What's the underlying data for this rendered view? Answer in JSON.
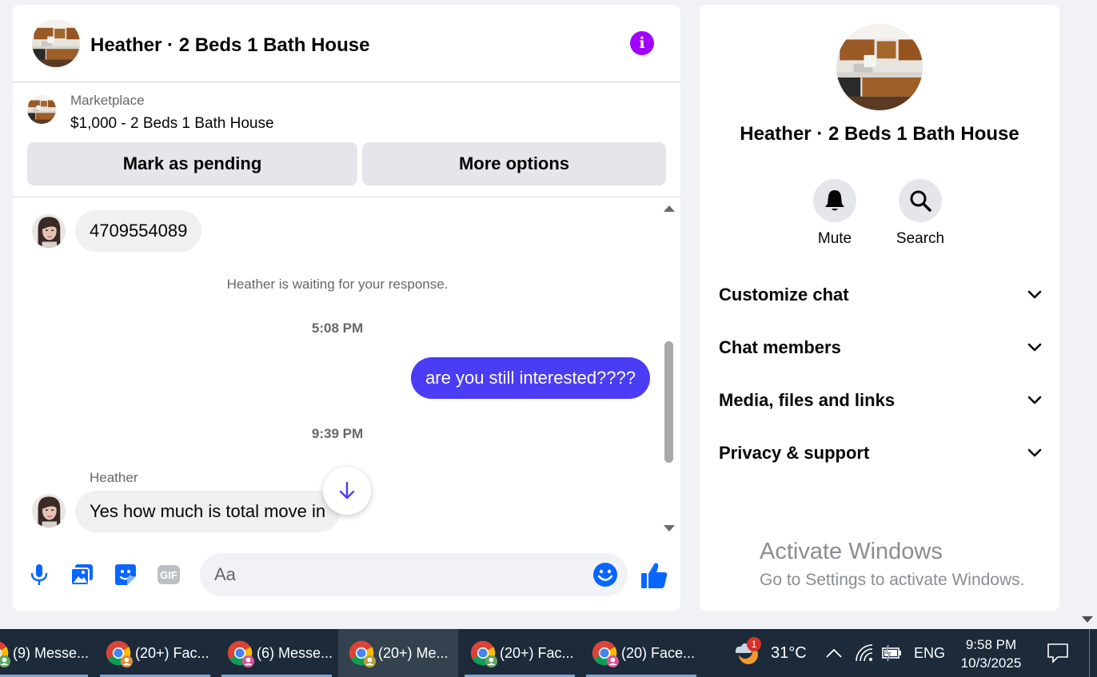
{
  "chat": {
    "title": "Heather · 2 Beds 1 Bath House",
    "listing": {
      "source": "Marketplace",
      "title": "$1,000 - 2 Beds 1 Bath House",
      "mark_pending_label": "Mark as pending",
      "more_options_label": "More options"
    },
    "messages": {
      "first_message": "4709554089",
      "waiting_notice": "Heather is waiting for your response.",
      "time_1": "5:08 PM",
      "outgoing_message": "are you still interested????",
      "time_2": "9:39 PM",
      "sender_name": "Heather",
      "last_message": "Yes how much is total move in"
    },
    "composer": {
      "placeholder": "Aa"
    }
  },
  "details": {
    "name": "Heather · 2 Beds 1 Bath House",
    "actions": {
      "mute_label": "Mute",
      "search_label": "Search"
    },
    "sections": [
      {
        "label": "Customize chat"
      },
      {
        "label": "Chat members"
      },
      {
        "label": "Media, files and links"
      },
      {
        "label": "Privacy & support"
      }
    ],
    "watermark": {
      "line1": "Activate Windows",
      "line2": "Go to Settings to activate Windows."
    }
  },
  "taskbar": {
    "tasks": [
      {
        "label": "(9) Messe...",
        "badge": "green"
      },
      {
        "label": "(20+) Fac...",
        "badge": "orange"
      },
      {
        "label": "(6) Messe...",
        "badge": "pink"
      },
      {
        "label": "(20+) Me...",
        "badge": "green"
      },
      {
        "label": "(20+) Fac...",
        "badge": "green"
      },
      {
        "label": "(20) Face...",
        "badge": "pink"
      }
    ],
    "weather_badge": "1",
    "temperature": "31°C",
    "language": "ENG",
    "time": "9:58 PM",
    "date": "10/3/2025"
  },
  "colors": {
    "accent": "#0866ff",
    "outgoing_bubble": "#4b3cf5",
    "info": "#a100ff",
    "taskbar": "#1c2a3a"
  }
}
